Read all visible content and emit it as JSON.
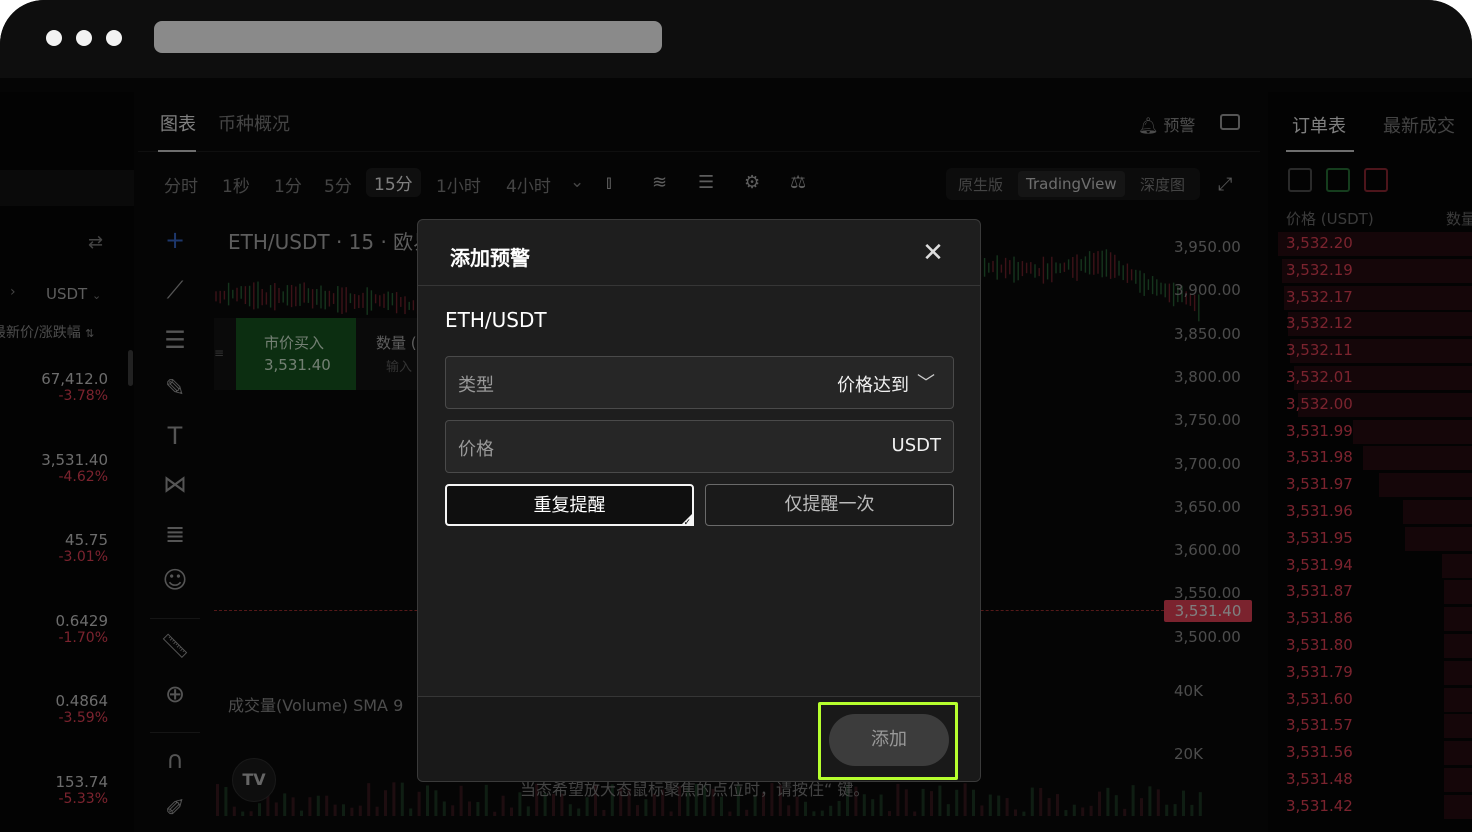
{
  "market_list": {
    "quote_currency": "USDT",
    "sort_label": "最新价/涨跌幅",
    "items": [
      {
        "price": "67,412.0",
        "change": "-3.78%"
      },
      {
        "price": "3,531.40",
        "change": "-4.62%"
      },
      {
        "price": "45.75",
        "change": "-3.01%"
      },
      {
        "price": "0.6429",
        "change": "-1.70%"
      },
      {
        "price": "0.4864",
        "change": "-3.59%"
      },
      {
        "price": "153.74",
        "change": "-5.33%"
      }
    ]
  },
  "chart_header": {
    "tabs": [
      "图表",
      "币种概况"
    ],
    "alert_label": "预警",
    "timeframes": [
      "分时",
      "1秒",
      "1分",
      "5分",
      "15分",
      "1小时",
      "4小时"
    ],
    "selected_timeframe": "15分",
    "view_modes": [
      "原生版",
      "TradingView",
      "深度图"
    ],
    "selected_view_mode": "TradingView"
  },
  "chart": {
    "symbol_title": "ETH/USDT · 15 · 欧易",
    "buy_label": "市价买入",
    "buy_price": "3,531.40",
    "qty_label": "数量 (",
    "qty_placeholder": "输入",
    "y_axis": [
      "3,950.00",
      "3,900.00",
      "3,850.00",
      "3,800.00",
      "3,750.00",
      "3,700.00",
      "3,650.00",
      "3,600.00",
      "3,550.00",
      "3,500.00"
    ],
    "current_price": "3,531.40",
    "volume_label": "成交量(Volume) SMA 9",
    "volume_axis": [
      "40K",
      "20K"
    ],
    "hint_text": "当态希望放大态鼠标聚焦的点位时，请按住“ 键。",
    "logo_text": "TV"
  },
  "order_book": {
    "tabs": [
      "订单表",
      "最新成交"
    ],
    "headers": [
      "价格 (USDT)",
      "数量"
    ],
    "asks": [
      "3,532.20",
      "3,532.19",
      "3,532.17",
      "3,532.12",
      "3,532.11",
      "3,532.01",
      "3,532.00",
      "3,531.99",
      "3,531.98",
      "3,531.97",
      "3,531.96",
      "3,531.95",
      "3,531.94",
      "3,531.87",
      "3,531.86",
      "3,531.80",
      "3,531.79",
      "3,531.60",
      "3,531.57",
      "3,531.56",
      "3,531.48",
      "3,531.42"
    ],
    "ask_depth": [
      0.98,
      0.96,
      0.95,
      0.93,
      0.92,
      0.9,
      0.88,
      0.6,
      0.55,
      0.47,
      0.35,
      0.34,
      0.15,
      0.14,
      0.14,
      0.14,
      0.14,
      0.14,
      0.14,
      0.14,
      0.14,
      0.14
    ]
  },
  "modal": {
    "title": "添加预警",
    "symbol": "ETH/USDT",
    "type_label": "类型",
    "type_value": "价格达到",
    "price_label": "价格",
    "price_value": "",
    "price_unit": "USDT",
    "option_repeat": "重复提醒",
    "option_once": "仅提醒一次",
    "add_button": "添加"
  },
  "colors": {
    "down": "#f6465d",
    "buy": "#1b7a2a",
    "highlight": "#b6ff2e"
  }
}
